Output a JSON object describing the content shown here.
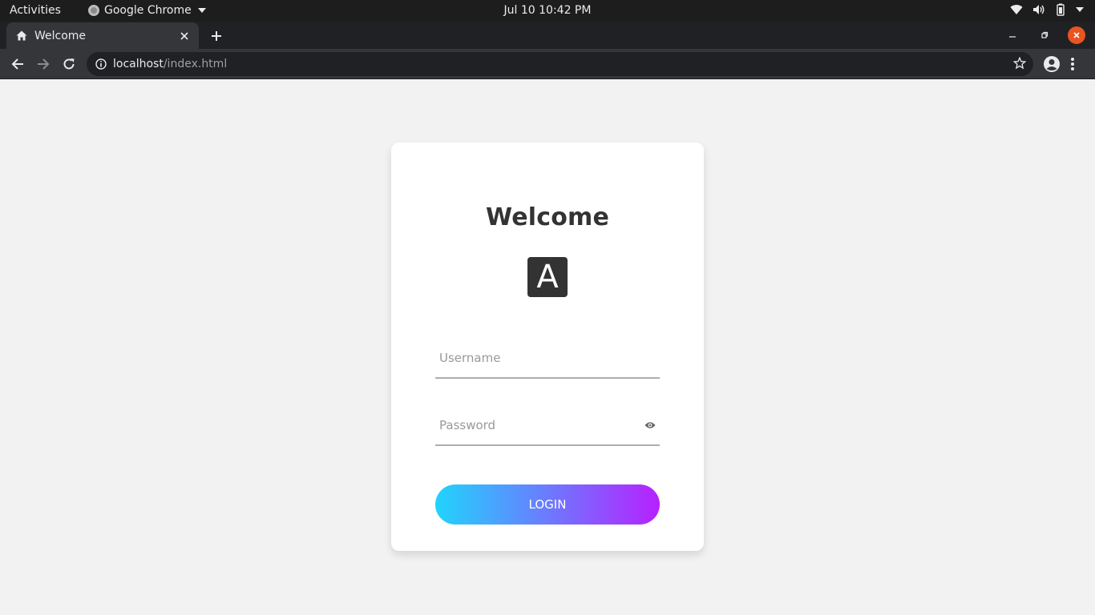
{
  "system_bar": {
    "activities": "Activities",
    "app_name": "Google Chrome",
    "clock": "Jul 10  10:42 PM"
  },
  "browser": {
    "tab": {
      "title": "Welcome",
      "icon": "home-icon"
    },
    "address": {
      "host": "localhost",
      "path": "/index.html"
    }
  },
  "login": {
    "title": "Welcome",
    "logo_letter": "A",
    "username_placeholder": "Username",
    "password_placeholder": "Password",
    "button_label": "LOGIN"
  },
  "colors": {
    "card_bg": "#ffffff",
    "page_bg": "#f2f2f2",
    "gradient_start": "#21d4fd",
    "gradient_end": "#b721ff",
    "text_dark": "#333333"
  }
}
